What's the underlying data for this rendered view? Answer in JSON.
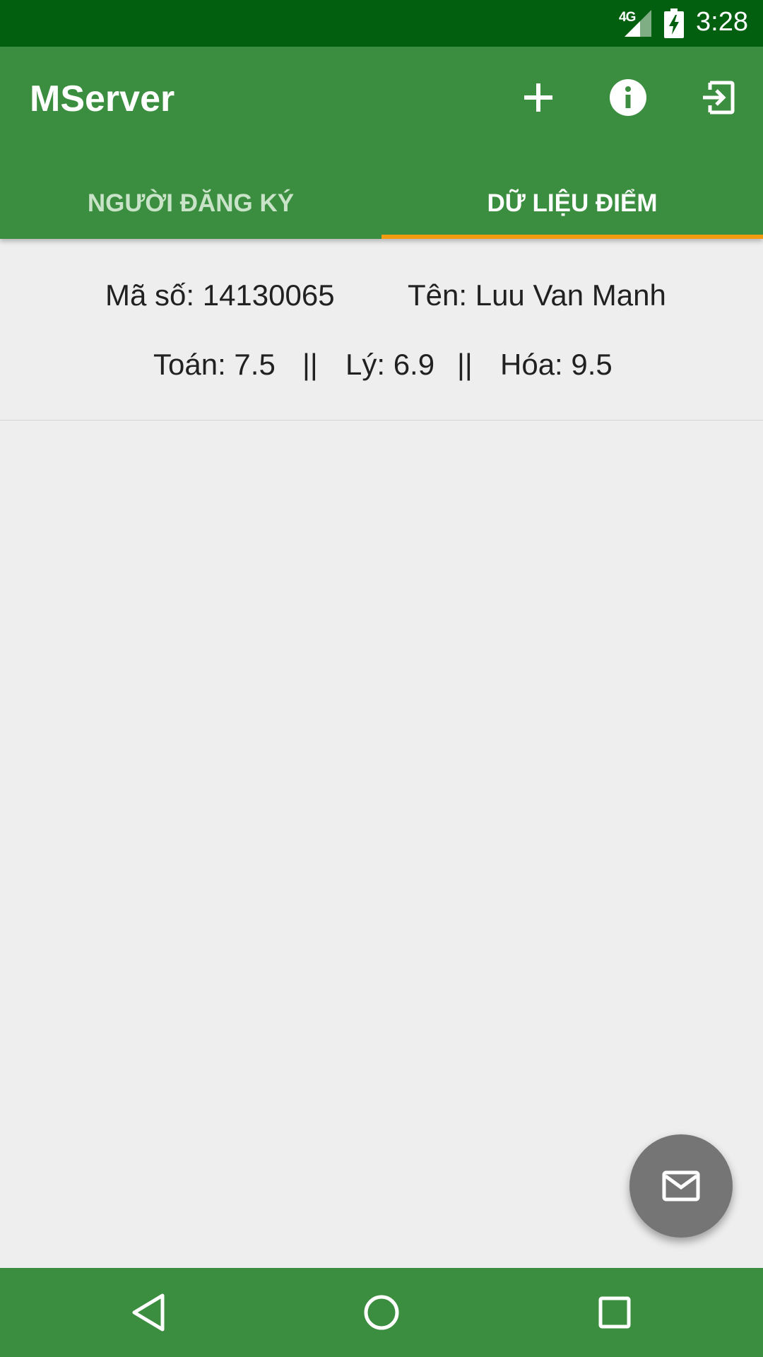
{
  "status_bar": {
    "network": "4G",
    "time": "3:28"
  },
  "app_bar": {
    "title": "MServer",
    "actions": [
      {
        "icon": "add-icon"
      },
      {
        "icon": "info-icon"
      },
      {
        "icon": "exit-icon"
      }
    ]
  },
  "tabs": [
    {
      "label": "NGƯỜI ĐĂNG KÝ",
      "active": false
    },
    {
      "label": "DỮ LIỆU ĐIỂM",
      "active": true
    }
  ],
  "records": [
    {
      "id_text": "Mã số: 14130065",
      "name_text": "Tên: Luu Van Manh",
      "math_text": "Toán: 7.5",
      "sep1": "||",
      "physics_text": "Lý: 6.9",
      "sep2": "||",
      "chemistry_text": "Hóa: 9.5"
    }
  ],
  "fab": {
    "icon": "mail-icon"
  },
  "nav": [
    {
      "icon": "back-icon"
    },
    {
      "icon": "home-icon"
    },
    {
      "icon": "recents-icon"
    }
  ],
  "colors": {
    "status_bar": "#015f0f",
    "primary": "#3b8e3f",
    "tab_indicator": "#f39c12",
    "background": "#eeeeee",
    "fab": "#757575"
  }
}
